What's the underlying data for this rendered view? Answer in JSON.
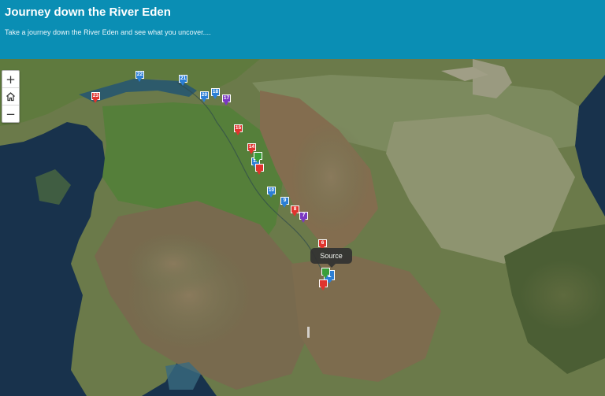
{
  "header": {
    "title": "Journey down the River Eden",
    "subtitle": "Take a journey down the River Eden and see what you uncover...."
  },
  "zoom_controls": [
    {
      "name": "zoom-in-button",
      "icon": "plus-icon",
      "glyph": "+"
    },
    {
      "name": "home-button",
      "icon": "home-icon",
      "glyph": ""
    },
    {
      "name": "zoom-out-button",
      "icon": "minus-icon",
      "glyph": "−"
    }
  ],
  "tooltip": {
    "label": "Source"
  },
  "colors": {
    "header": "#0a8eb4",
    "pin_blue": "#2c7fd6",
    "pin_red": "#e0342e",
    "pin_purple": "#7b38c2",
    "pin_green": "#3a9e3a"
  },
  "markers": [
    {
      "label": "1",
      "color": "blue",
      "size": "big"
    },
    {
      "label": "6",
      "color": "red"
    },
    {
      "label": "7",
      "color": "purple"
    },
    {
      "label": "8",
      "color": "red"
    },
    {
      "label": "9",
      "color": "blue"
    },
    {
      "label": "10",
      "color": "blue"
    },
    {
      "label": "11",
      "color": "blue"
    },
    {
      "label": "14",
      "color": "red"
    },
    {
      "label": "15",
      "color": "red"
    },
    {
      "label": "17",
      "color": "purple"
    },
    {
      "label": "18",
      "color": "blue"
    },
    {
      "label": "20",
      "color": "blue"
    },
    {
      "label": "21",
      "color": "blue"
    },
    {
      "label": "22",
      "color": "blue"
    },
    {
      "label": "23",
      "color": "red"
    },
    {
      "label": "",
      "color": "red"
    },
    {
      "label": "",
      "color": "red"
    },
    {
      "label": "",
      "color": "green"
    },
    {
      "label": "",
      "color": "green"
    }
  ]
}
